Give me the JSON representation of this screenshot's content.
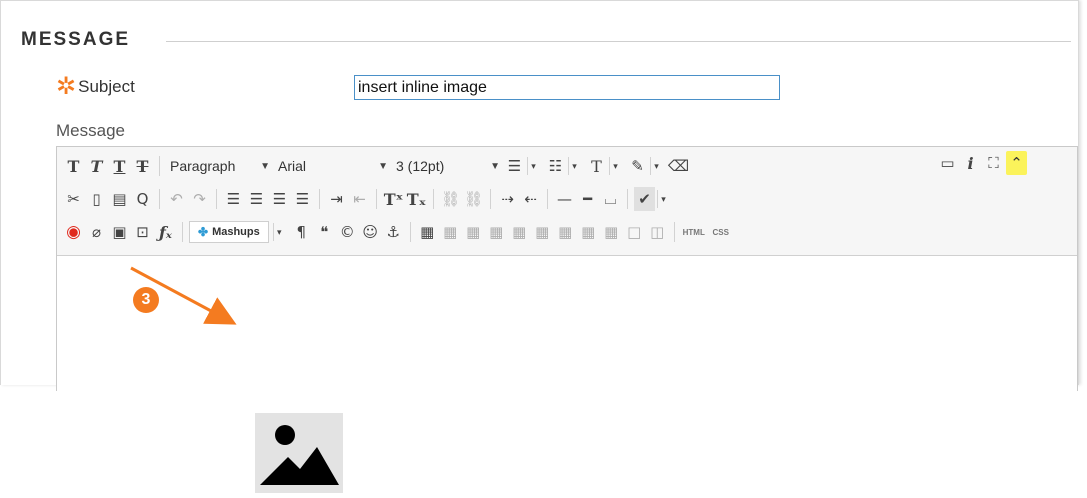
{
  "section": {
    "title": "MESSAGE"
  },
  "subject": {
    "label": "Subject",
    "value": "insert inline image",
    "required_icon": "asterisk-icon"
  },
  "message": {
    "label": "Message"
  },
  "toolbar": {
    "paragraph": "Paragraph",
    "font": "Arial",
    "size": "3 (12pt)",
    "mashups": "Mashups",
    "html_label": "HTML",
    "css_label": "CSS"
  },
  "annotation": {
    "step": "3",
    "color": "#f47b20"
  },
  "colors": {
    "accent": "#f47b20",
    "input_border": "#4a90c8",
    "highlight": "#fbf35b"
  }
}
